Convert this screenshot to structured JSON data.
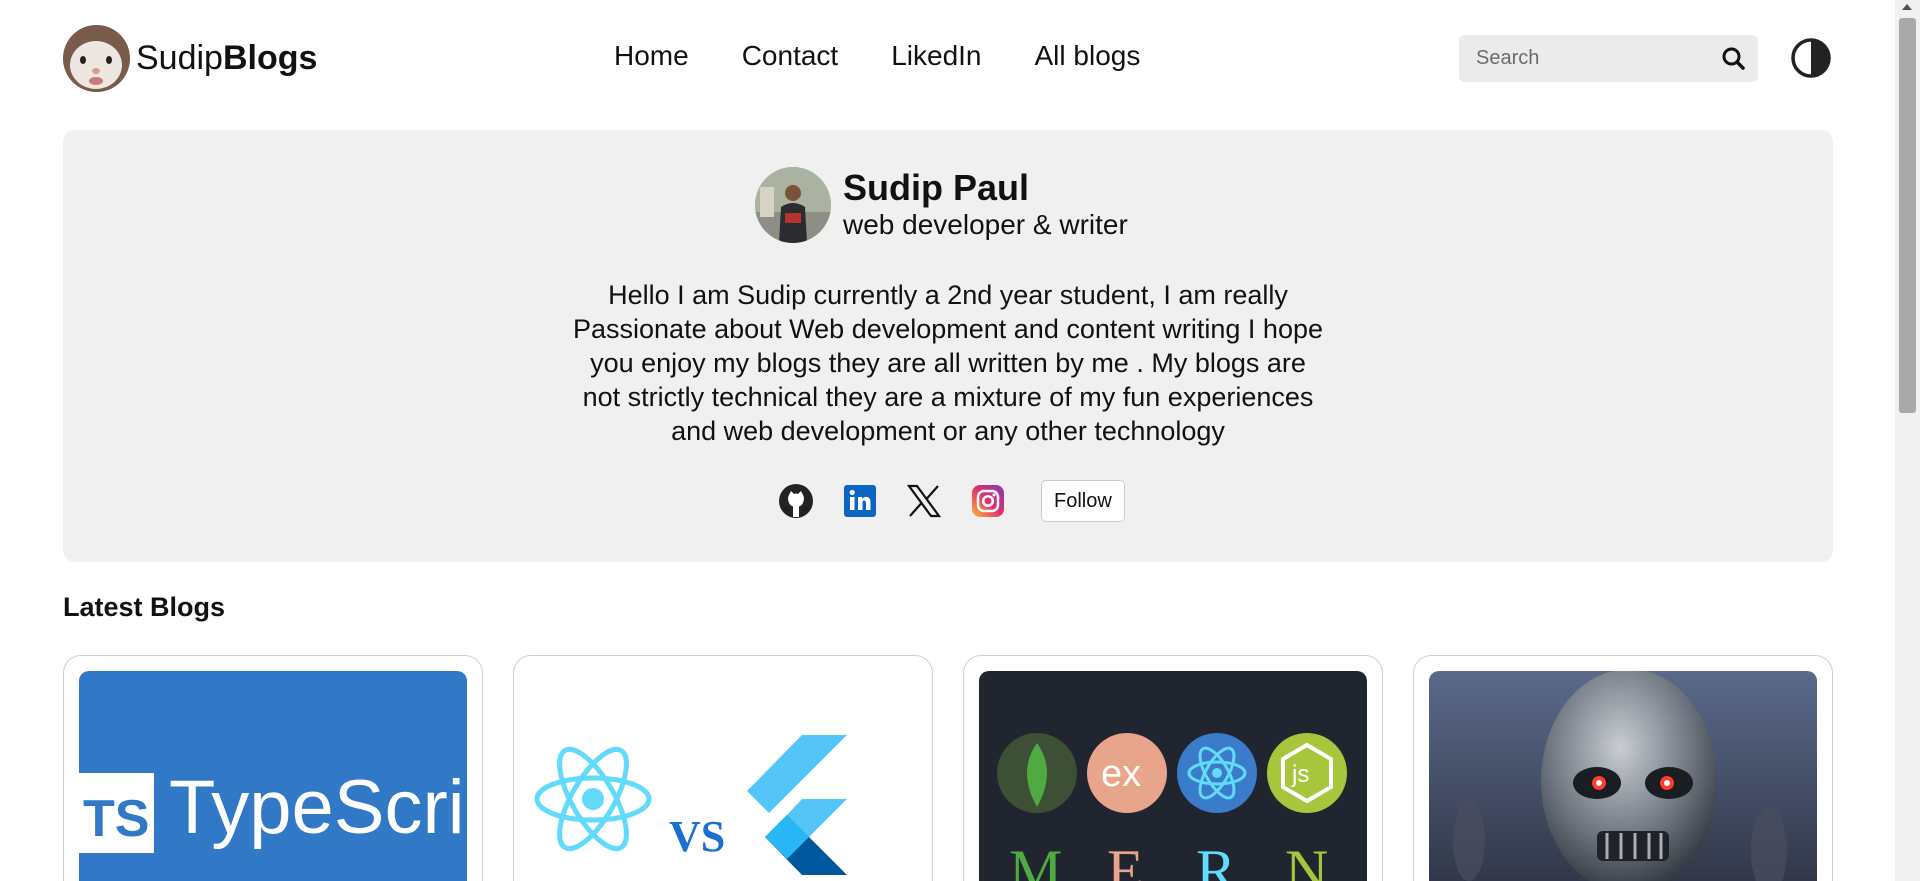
{
  "header": {
    "logo_prefix": "Sudip",
    "logo_bold": "Blogs",
    "nav": [
      {
        "label": "Home"
      },
      {
        "label": "Contact"
      },
      {
        "label": "LikedIn"
      },
      {
        "label": "All blogs"
      }
    ],
    "search_placeholder": "Search",
    "search_icon": "search-icon",
    "theme_icon": "contrast-icon"
  },
  "profile": {
    "name": "Sudip Paul",
    "role": "web developer & writer",
    "bio": "Hello I am Sudip currently a 2nd year student, I am really Passionate about Web development and content writing I hope you enjoy my blogs they are all written by me . My blogs are not strictly technical they are a mixture of my fun experiences and web development or any other technology"
  },
  "socials": [
    {
      "icon": "github-icon"
    },
    {
      "icon": "linkedin-icon"
    },
    {
      "icon": "x-icon"
    },
    {
      "icon": "instagram-icon"
    }
  ],
  "follow_label": "Follow",
  "latest_title": "Latest Blogs",
  "cards": [
    {
      "image": "typescript-logo",
      "text": "TypeScript",
      "badge": "TS"
    },
    {
      "image": "react-vs-flutter",
      "text": "VS"
    },
    {
      "image": "mern-stack",
      "letters": [
        "M",
        "E",
        "R",
        "N"
      ],
      "ex_text": "ex",
      "js_text": "js"
    },
    {
      "image": "terminator-robot"
    }
  ],
  "colors": {
    "hero_bg": "#f0f0f0",
    "typescript_blue": "#3178c6",
    "react_cyan": "#61dafb",
    "flutter_blue": "#54c5f8",
    "mern_bg": "#21252f"
  }
}
